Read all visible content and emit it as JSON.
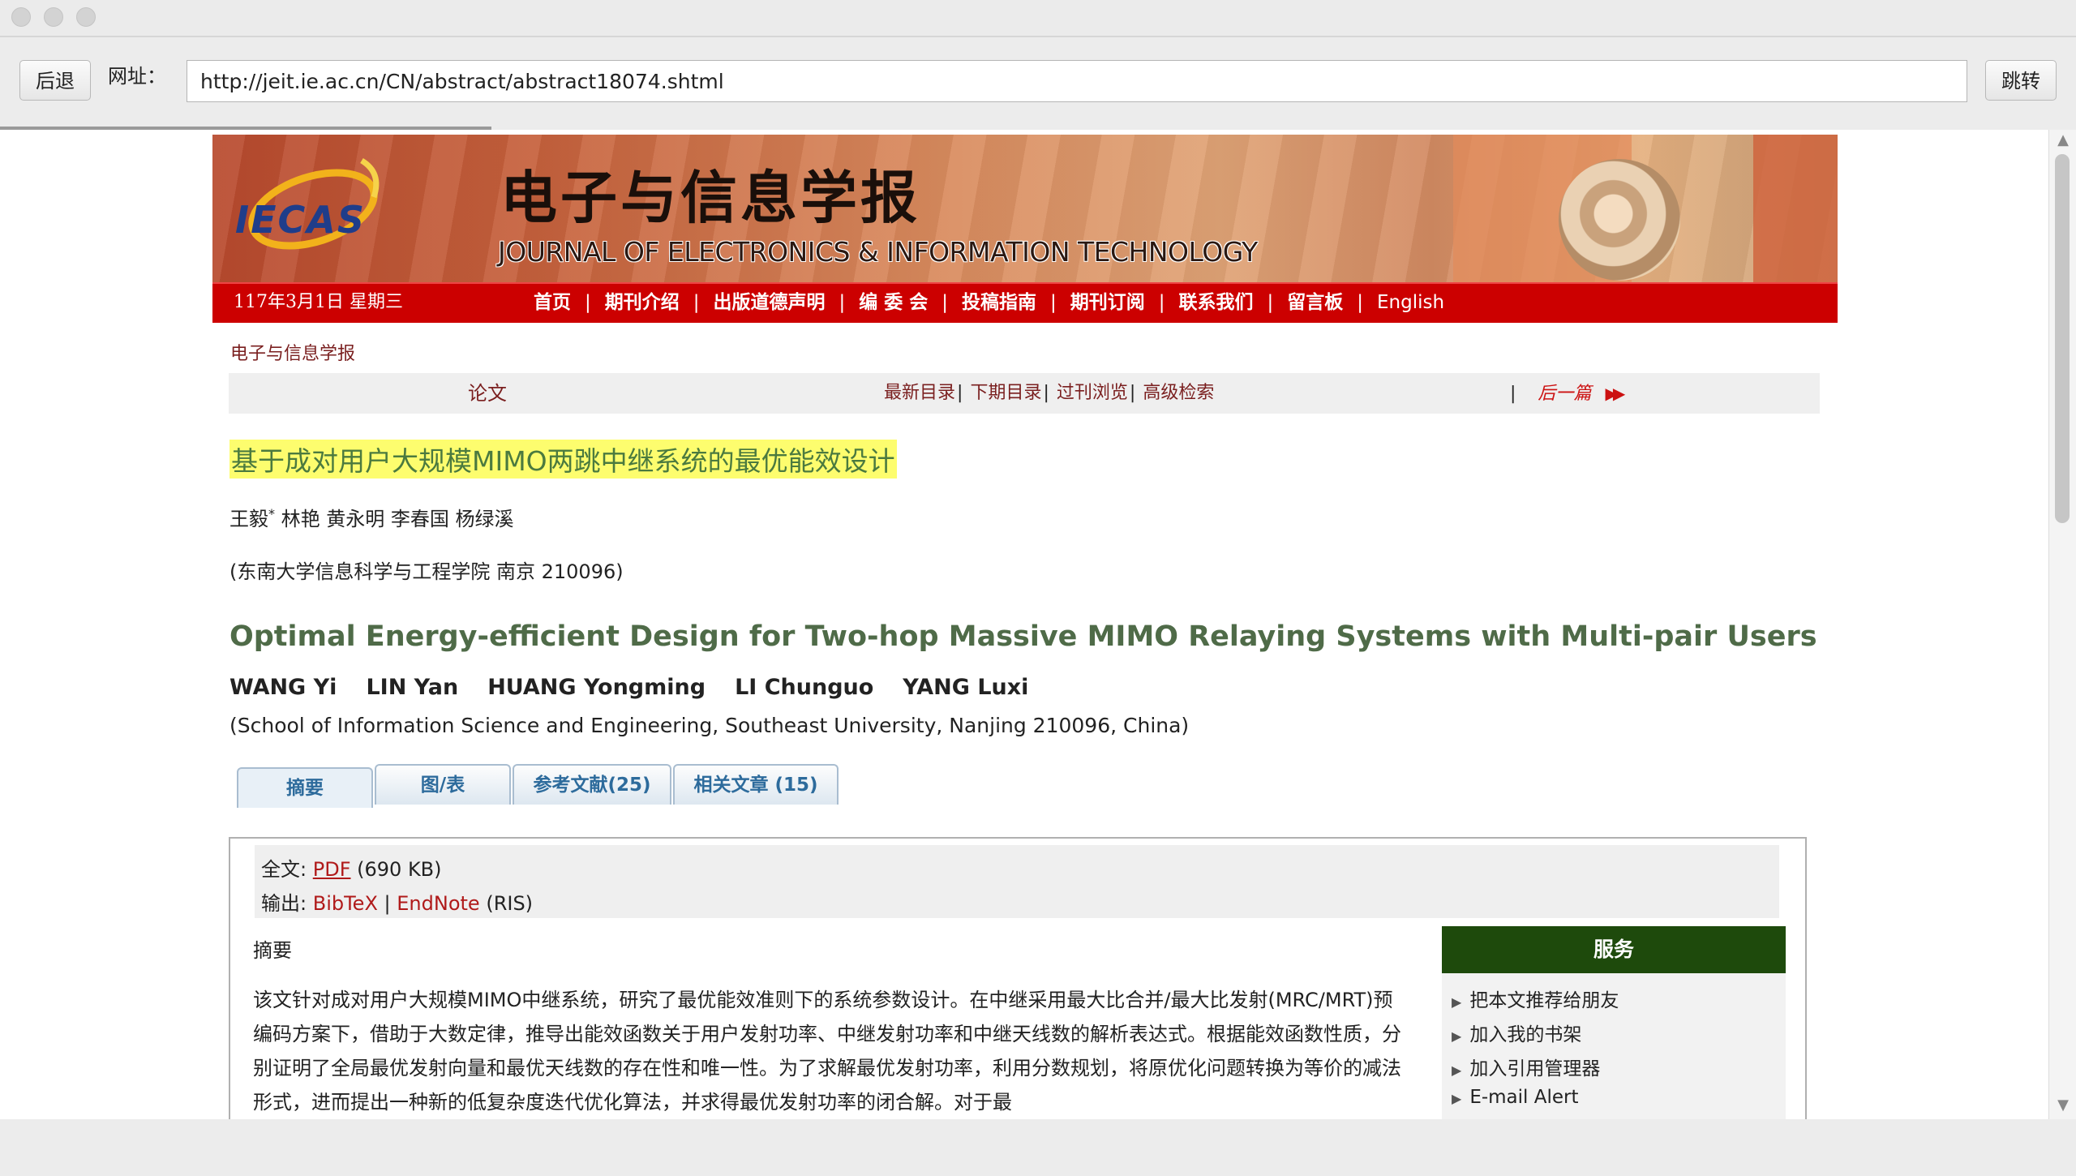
{
  "browser": {
    "back_label": "后退",
    "url_label": "网址：",
    "url": "http://jeit.ie.ac.cn/CN/abstract/abstract18074.shtml",
    "go_label": "跳转"
  },
  "banner": {
    "logo": "IECAS",
    "journal_cn": "电子与信息学报",
    "journal_en": "JOURNAL OF ELECTRONICS & INFORMATION TECHNOLOGY"
  },
  "nav": {
    "date": "117年3月1日 星期三",
    "links": [
      "首页",
      "期刊介绍",
      "出版道德声明",
      "编 委 会",
      "投稿指南",
      "期刊订阅",
      "联系我们",
      "留言板",
      "English"
    ]
  },
  "breadcrumb": "电子与信息学报",
  "article_bar": {
    "label": "论文",
    "links": [
      "最新目录",
      "下期目录",
      "过刊浏览",
      "高级检索"
    ],
    "separator": "|",
    "next_label": "后一篇",
    "next_arrows": "▶▶"
  },
  "article": {
    "title_cn": "基于成对用户大规模MIMO两跳中继系统的最优能效设计",
    "authors_cn": "王毅",
    "authors_cn_mark": "*",
    "authors_cn_rest": " 林艳  黄永明  李春国  杨绿溪",
    "affiliation_cn": "(东南大学信息科学与工程学院  南京  210096)",
    "title_en": "Optimal Energy-efficient Design for Two-hop Massive MIMO Relaying Systems with Multi-pair Users",
    "authors_en": [
      "WANG Yi",
      "LIN Yan",
      "HUANG Yongming",
      "LI Chunguo",
      "YANG Luxi"
    ],
    "affiliation_en": "(School of Information Science and Engineering, Southeast University, Nanjing 210096, China)"
  },
  "tabs": [
    "摘要",
    "图/表",
    "参考文献(25)",
    "相关文章 (15)"
  ],
  "fulltext": {
    "label": "全文:",
    "pdf": "PDF",
    "pdf_size": "(690 KB)",
    "export_label": "输出:",
    "bibtex": "BibTeX",
    "sep": "|",
    "endnote": "EndNote",
    "ris": "(RIS)"
  },
  "abstract": {
    "heading": "摘要",
    "text": "该文针对成对用户大规模MIMO中继系统，研究了最优能效准则下的系统参数设计。在中继采用最大比合并/最大比发射(MRC/MRT)预编码方案下，借助于大数定律，推导出能效函数关于用户发射功率、中继发射功率和中继天线数的解析表达式。根据能效函数性质，分别证明了全局最优发射向量和最优天线数的存在性和唯一性。为了求解最优发射功率，利用分数规划，将原优化问题转换为等价的减法形式，进而提出一种新的低复杂度迭代优化算法，并求得最优发射功率的闭合解。对于最"
  },
  "service": {
    "heading": "服务",
    "items": [
      "把本文推荐给朋友",
      "加入我的书架",
      "加入引用管理器",
      "E-mail Alert"
    ]
  },
  "colors": {
    "nav_red": "#cc0000",
    "title_highlight": "#fdfd6e",
    "title_green": "#4b7a3f",
    "service_green": "#1e4a0c",
    "link_red": "#b01a1a",
    "tab_blue": "#2d6b9c"
  }
}
